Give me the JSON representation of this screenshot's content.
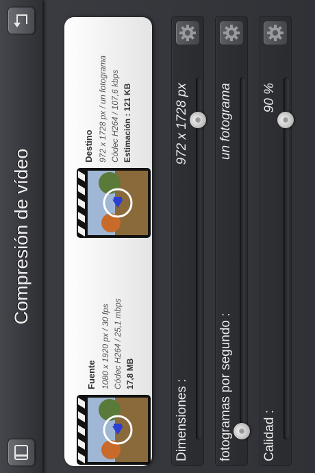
{
  "header": {
    "title": "Compresión de vídeo",
    "left_button_icon": "sidebar-book-icon",
    "right_button_icon": "back-arrow-icon"
  },
  "source": {
    "title": "Fuente",
    "resolution": "1080 x 1920 px / 30 fps",
    "codec": "Códec H264 / 25,1 mbps",
    "size": "17,8 MB"
  },
  "destination": {
    "title": "Destino",
    "resolution": "972 x 1728 px / un fotograma",
    "codec": "Códec H264 / 107,6 kbps",
    "estimate": "Estimación : 121 KB"
  },
  "settings": [
    {
      "label": "Dimensiones :",
      "value": "972 x 1728 px",
      "level": 0.9
    },
    {
      "label": "fotogramas por segundo :",
      "value": "un fotograma",
      "level": 0.0
    },
    {
      "label": "Calidad :",
      "value": "90 %",
      "level": 0.9
    }
  ],
  "colors": {
    "panel_bg": "#f2f2f2",
    "app_bg": "#36373c",
    "text_light": "#eaeaea"
  }
}
